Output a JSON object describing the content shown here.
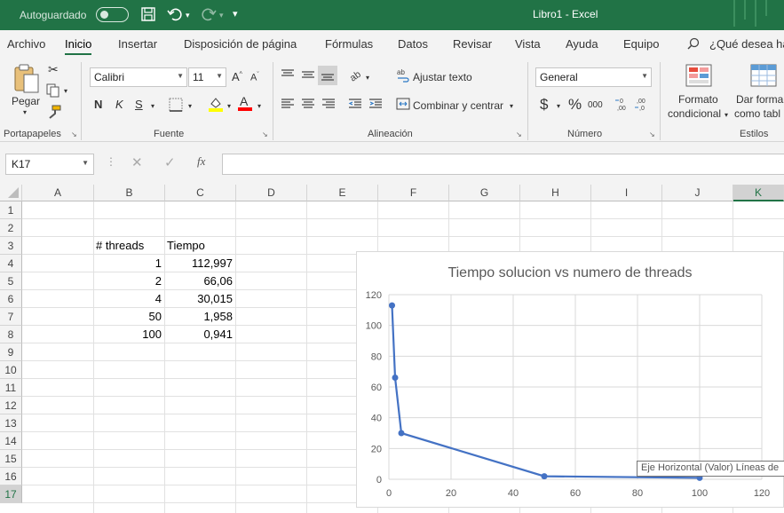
{
  "titlebar": {
    "autosave_label": "Autoguardado",
    "autosave_state": "off",
    "document_title": "Libro1 - Excel",
    "save_icon": "save-icon",
    "undo_icon": "undo-icon",
    "redo_icon": "redo-icon",
    "customize_icon": "customize-quick-access-icon"
  },
  "tabs": [
    "Archivo",
    "Inicio",
    "Insertar",
    "Disposición de página",
    "Fórmulas",
    "Datos",
    "Revisar",
    "Vista",
    "Ayuda",
    "Equipo"
  ],
  "active_tab": "Inicio",
  "tell_me": "¿Qué desea ha",
  "ribbon": {
    "clipboard": {
      "paste_label": "Pegar",
      "group_label": "Portapapeles"
    },
    "font": {
      "name": "Calibri",
      "size": "11",
      "bold": "N",
      "italic": "K",
      "underline": "S",
      "group_label": "Fuente",
      "fill_color": "#ffff00",
      "font_color": "#ff0000"
    },
    "alignment": {
      "wrap_label": "Ajustar texto",
      "merge_label": "Combinar y centrar",
      "group_label": "Alineación"
    },
    "number": {
      "format": "General",
      "currency": "$",
      "percent": "%",
      "thousands": "000",
      "group_label": "Número"
    },
    "styles": {
      "conditional_line1": "Formato",
      "conditional_line2": "condicional",
      "table_line1": "Dar forma",
      "table_line2": "como tabl",
      "group_label": "Estilos"
    }
  },
  "formula_bar": {
    "name_box": "K17",
    "fx": "fx",
    "formula": ""
  },
  "sheet": {
    "columns": [
      "A",
      "B",
      "C",
      "D",
      "E",
      "F",
      "G",
      "H",
      "I",
      "J",
      "K"
    ],
    "selected_column": "K",
    "rows": [
      "1",
      "2",
      "3",
      "4",
      "5",
      "6",
      "7",
      "8",
      "9",
      "10",
      "11",
      "12",
      "13",
      "14",
      "15",
      "16",
      "17"
    ],
    "selected_row": "17",
    "header_b": "# threads",
    "header_c": "Tiempo",
    "b_values": [
      "1",
      "2",
      "4",
      "50",
      "100"
    ],
    "c_values": [
      "112,997",
      "66,06",
      "30,015",
      "1,958",
      "0,941"
    ]
  },
  "chart_data": {
    "type": "scatter",
    "title": "Tiempo solucion vs numero de threads",
    "xlabel": "",
    "ylabel": "",
    "xlim": [
      0,
      120
    ],
    "ylim": [
      0,
      120
    ],
    "xticks": [
      "0",
      "20",
      "40",
      "60",
      "80",
      "100",
      "120"
    ],
    "yticks": [
      "0",
      "20",
      "40",
      "60",
      "80",
      "100",
      "120"
    ],
    "grid": true,
    "series_color": "#4472c4",
    "series": [
      {
        "x": [
          1,
          2,
          4,
          50,
          100
        ],
        "y": [
          112.997,
          66.06,
          30.015,
          1.958,
          0.941
        ]
      }
    ]
  },
  "tooltip": "Eje Horizontal (Valor)  Líneas de"
}
